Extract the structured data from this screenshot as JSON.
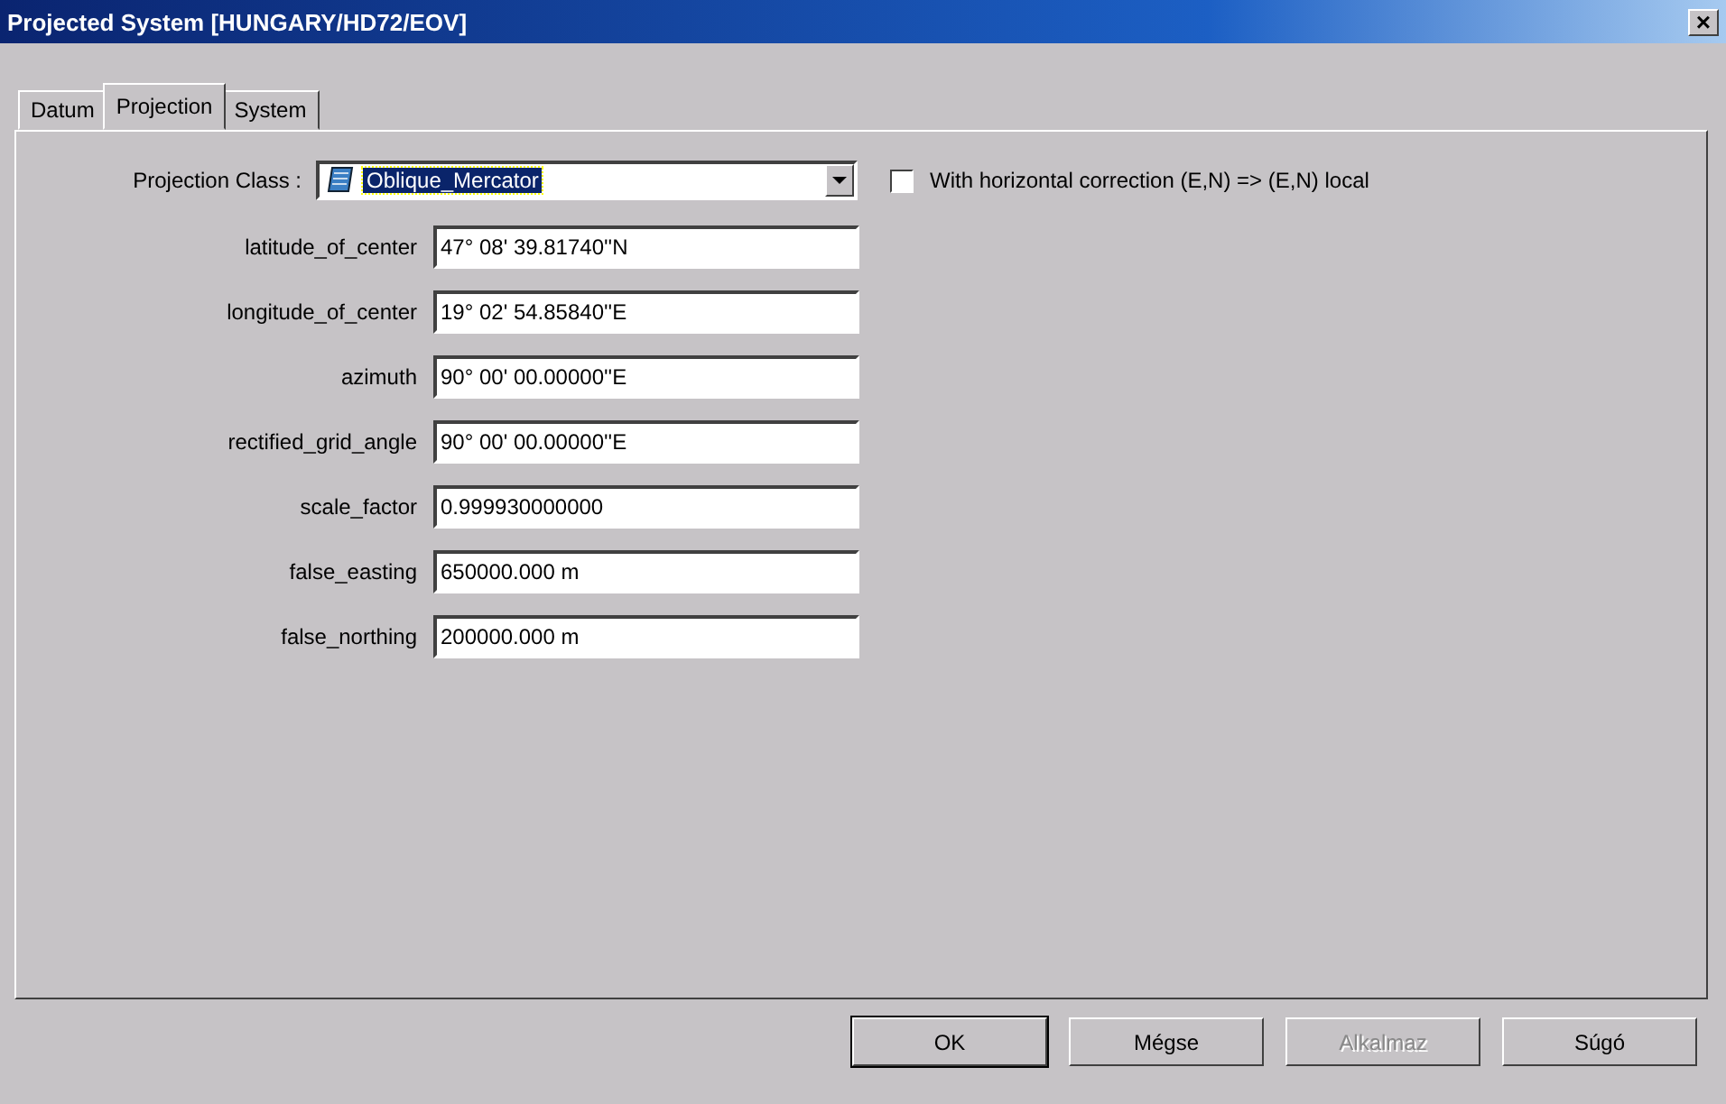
{
  "window": {
    "title": "Projected System [HUNGARY/HD72/EOV]",
    "close": "×"
  },
  "tabs": [
    {
      "label": "Datum",
      "selected": false
    },
    {
      "label": "Projection",
      "selected": true
    },
    {
      "label": "System",
      "selected": false
    }
  ],
  "projection_class": {
    "label": "Projection Class :",
    "value": "Oblique_Mercator"
  },
  "correction": {
    "label": "With horizontal correction (E,N) => (E,N) local",
    "checked": false
  },
  "parameters": [
    {
      "label": "latitude_of_center",
      "value": "47° 08' 39.81740''N"
    },
    {
      "label": "longitude_of_center",
      "value": "19° 02' 54.85840''E"
    },
    {
      "label": "azimuth",
      "value": "90° 00' 00.00000''E"
    },
    {
      "label": "rectified_grid_angle",
      "value": "90° 00' 00.00000''E"
    },
    {
      "label": "scale_factor",
      "value": "0.999930000000"
    },
    {
      "label": "false_easting",
      "value": "650000.000 m"
    },
    {
      "label": "false_northing",
      "value": "200000.000 m"
    }
  ],
  "buttons": [
    {
      "label": "OK",
      "disabled": false,
      "default": true
    },
    {
      "label": "Mégse",
      "disabled": false,
      "default": false
    },
    {
      "label": "Alkalmaz",
      "disabled": true,
      "default": false
    },
    {
      "label": "Súgó",
      "disabled": false,
      "default": false
    }
  ]
}
